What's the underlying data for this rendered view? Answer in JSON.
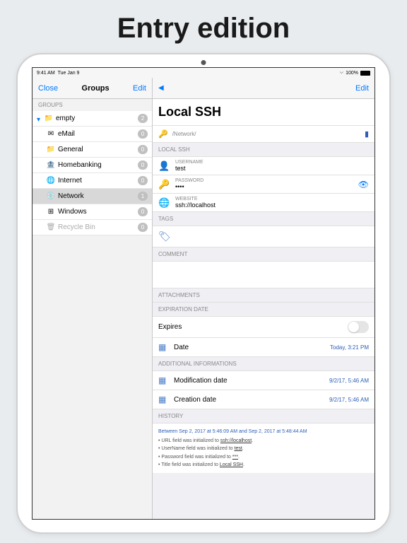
{
  "hero": "Entry edition",
  "status": {
    "time": "9:41 AM",
    "date": "Tue Jan 9",
    "wifi": "⌔",
    "battery": "100%"
  },
  "sidebar": {
    "close": "Close",
    "title": "Groups",
    "edit": "Edit",
    "section": "GROUPS",
    "items": [
      {
        "name": "empty",
        "count": "2",
        "indent": 0,
        "icon": "📁",
        "expandable": true
      },
      {
        "name": "eMail",
        "count": "0",
        "indent": 1,
        "icon": "✉"
      },
      {
        "name": "General",
        "count": "0",
        "indent": 1,
        "icon": "📁"
      },
      {
        "name": "Homebanking",
        "count": "0",
        "indent": 1,
        "icon": "🏦"
      },
      {
        "name": "Internet",
        "count": "0",
        "indent": 1,
        "icon": "🌐"
      },
      {
        "name": "Network",
        "count": "1",
        "indent": 1,
        "icon": "💿",
        "selected": true
      },
      {
        "name": "Windows",
        "count": "0",
        "indent": 1,
        "icon": "⊞"
      },
      {
        "name": "Recycle Bin",
        "count": "0",
        "indent": 1,
        "icon": "🗑",
        "dim": true
      }
    ]
  },
  "detail": {
    "back": "◀",
    "edit": "Edit",
    "title": "Local SSH",
    "breadcrumb": "/Network/",
    "sections": {
      "local_ssh": "LOCAL SSH",
      "tags": "TAGS",
      "comment": "COMMENT",
      "attachments": "ATTACHMENTS",
      "expiration": "EXPIRATION DATE",
      "additional": "ADDITIONAL INFORMATIONS",
      "history": "HISTORY"
    },
    "fields": {
      "username_label": "USERNAME",
      "username": "test",
      "password_label": "PASSWORD",
      "password": "••••",
      "website_label": "WEBSITE",
      "website": "ssh://localhost"
    },
    "expires_label": "Expires",
    "date_label": "Date",
    "date_value": "Today, 3:21 PM",
    "mod_label": "Modification date",
    "mod_value": "9/2/17, 5:46 AM",
    "creation_label": "Creation date",
    "creation_value": "9/2/17, 5:46 AM",
    "history_header": "Between Sep 2, 2017 at 5:46:09 AM and Sep 2, 2017 at 5:48:44 AM",
    "history_lines": [
      {
        "pre": "URL field was initialized to ",
        "link": "ssh://localhost"
      },
      {
        "pre": "UserName field was initialized to ",
        "link": "test"
      },
      {
        "pre": "Password field was initialized to ",
        "link": "***"
      },
      {
        "pre": "Title field was initialized to ",
        "link": "Local SSH"
      }
    ]
  }
}
